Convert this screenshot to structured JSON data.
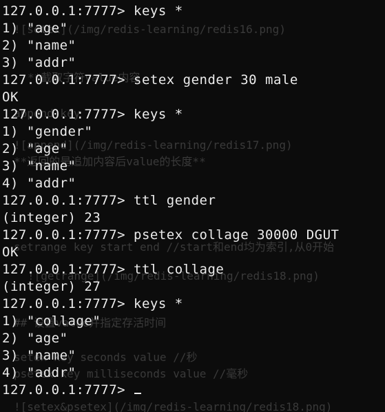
{
  "terminal": {
    "lines": [
      "127.0.0.1:7777> keys *",
      "1) \"age\"",
      "2) \"name\"",
      "3) \"addr\"",
      "127.0.0.1:7777> setex gender 30 male",
      "OK",
      "127.0.0.1:7777> keys *",
      "1) \"gender\"",
      "2) \"age\"",
      "3) \"name\"",
      "4) \"addr\"",
      "127.0.0.1:7777> ttl gender",
      "(integer) 23",
      "127.0.0.1:7777> psetex collage 30000 DGUT",
      "OK",
      "127.0.0.1:7777> ttl collage",
      "(integer) 27",
      "127.0.0.1:7777> keys *",
      "1) \"collage\"",
      "2) \"age\"",
      "3) \"name\"",
      "4) \"addr\"",
      "127.0.0.1:7777> "
    ]
  },
  "background_text": [
    "![setex](/img/redis-learning/redis16.png)",
    "**截取字符value内容",
    "append key",
    "![append](/img/redis-learning/redis17.png)",
    "**返回的是追加内容后value的长度**",
    "setrange key start end //start和end均为索引,从0开始",
    "![getrange](/img/redis-learning/redis18.png)",
    "## 设置value并指定存活时间",
    "setex key seconds value //秒",
    "psetex key milliseconds value //毫秒",
    "![setex&psetex](/img/redis-learning/redis18.png)"
  ],
  "colors": {
    "background": "#0c0c0c",
    "foreground": "#ececec",
    "ghost_text": "#3a3a3a"
  }
}
